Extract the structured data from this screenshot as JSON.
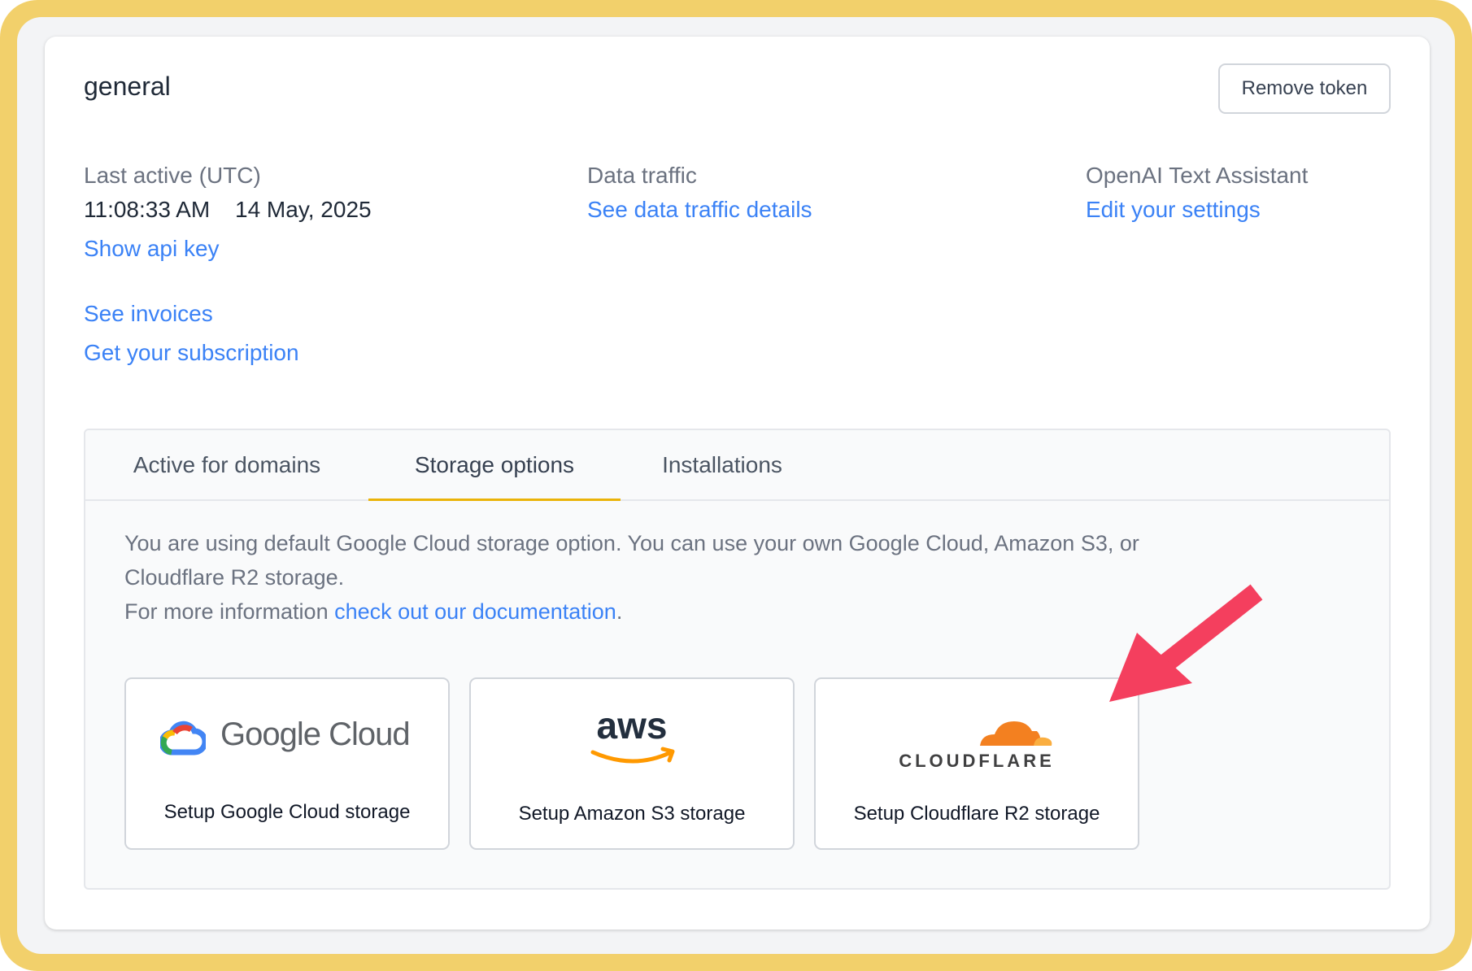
{
  "token": {
    "name": "general",
    "remove_label": "Remove token"
  },
  "info": {
    "last_active_label": "Last active (UTC)",
    "last_active_time": "11:08:33 AM",
    "last_active_date": "14 May, 2025",
    "show_api_key": "Show api key",
    "see_invoices": "See invoices",
    "get_subscription": "Get your subscription",
    "data_traffic_label": "Data traffic",
    "data_traffic_link": "See data traffic details",
    "openai_label": "OpenAI Text Assistant",
    "openai_link": "Edit your settings"
  },
  "tabs": [
    {
      "label": "Active for domains",
      "active": false
    },
    {
      "label": "Storage options",
      "active": true
    },
    {
      "label": "Installations",
      "active": false
    }
  ],
  "storage": {
    "description_line1": "You are using default Google Cloud storage option. You can use your own Google Cloud, Amazon S3, or",
    "description_line2": "Cloudflare R2 storage.",
    "more_info_prefix": "For more information ",
    "doc_link": "check out our documentation",
    "more_info_suffix": ".",
    "options": [
      {
        "logo_text": "Google Cloud",
        "label": "Setup Google Cloud storage",
        "icon": "google-cloud-icon"
      },
      {
        "logo_text": "aws",
        "label": "Setup Amazon S3 storage",
        "icon": "aws-icon"
      },
      {
        "logo_text": "CLOUDFLARE",
        "label": "Setup Cloudflare R2 storage",
        "icon": "cloudflare-icon"
      }
    ]
  },
  "colors": {
    "frame": "#f2d06b",
    "link": "#3b82f6",
    "tab_indicator": "#eab308",
    "arrow": "#f43f5e",
    "cloudflare_orange": "#f38020",
    "aws_orange": "#ff9900"
  }
}
